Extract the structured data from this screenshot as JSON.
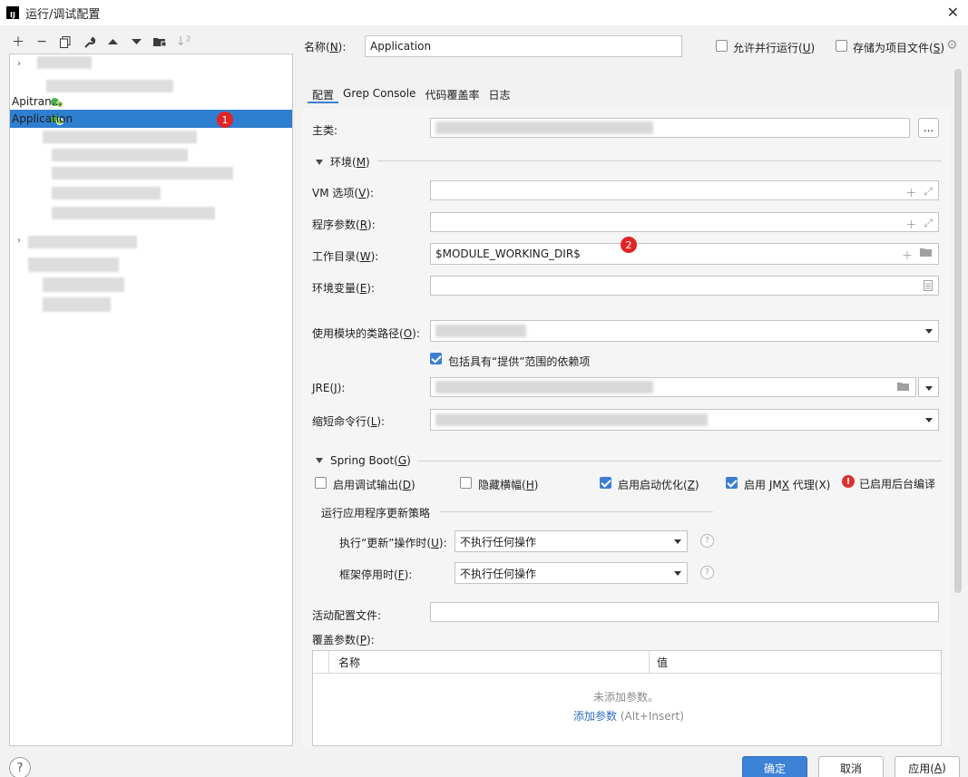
{
  "window": {
    "title": "运行/调试配置",
    "logo": "IJ"
  },
  "left_toolbar": {
    "icons": [
      "plus-icon",
      "minus-icon",
      "copy-icon",
      "wrench-icon",
      "arrow-up-icon",
      "arrow-down-icon",
      "folder-add-icon",
      "sort-icon"
    ]
  },
  "tree": {
    "items": [
      {
        "label": "Apitran...",
        "selected": false
      },
      {
        "label": "Application",
        "selected": true
      }
    ],
    "badge1": "1"
  },
  "name_field": {
    "label_pre": "名称(",
    "label_key": "N",
    "label_post": "):",
    "value": "Application"
  },
  "options": {
    "allow_parallel": {
      "label_pre": "允许并行运行(",
      "label_key": "U",
      "label_post": ")",
      "checked": false
    },
    "store_as_file": {
      "label_pre": "存储为项目文件(",
      "label_key": "S",
      "label_post": ")",
      "checked": false
    }
  },
  "tabs": [
    "配置",
    "Grep Console",
    "代码覆盖率",
    "日志"
  ],
  "main_class": {
    "label": "主类:",
    "browse": "..."
  },
  "env_section": {
    "title_pre": "环境(",
    "title_key": "M",
    "title_post": ")"
  },
  "vm_options": {
    "label_pre": "VM 选项(",
    "label_key": "V",
    "label_post": "):"
  },
  "program_args": {
    "label_pre": "程序参数(",
    "label_key": "R",
    "label_post": "):"
  },
  "working_dir": {
    "label_pre": "工作目录(",
    "label_key": "W",
    "label_post": "):",
    "value": "$MODULE_WORKING_DIR$",
    "badge2": "2"
  },
  "env_vars": {
    "label_pre": "环境变量(",
    "label_key": "E",
    "label_post": "):"
  },
  "module_classpath": {
    "label_pre": "使用模块的类路径(",
    "label_key": "O",
    "label_post": "):"
  },
  "include_provided": {
    "label": "包括具有“提供”范围的依赖项",
    "checked": true
  },
  "jre": {
    "label_pre": "JRE(",
    "label_key": "J",
    "label_post": "):"
  },
  "shorten_cmd": {
    "label_pre": "缩短命令行(",
    "label_key": "L",
    "label_post": "):"
  },
  "spring_boot": {
    "title_pre": "Spring Boot(",
    "title_key": "G",
    "title_post": ")",
    "debug_output": {
      "label_pre": "启用调试输出(",
      "label_key": "D",
      "label_post": ")",
      "checked": false
    },
    "hide_banner": {
      "label_pre": "隐藏横幅(",
      "label_key": "H",
      "label_post": ")",
      "checked": false
    },
    "launch_opt": {
      "label_pre": "启用启动优化(",
      "label_key": "Z",
      "label_post": ")",
      "checked": true
    },
    "jmx_agent": {
      "label_pre": "启用 JM",
      "label_key": "X",
      "label_post": " 代理(X)",
      "checked": true
    },
    "bg_compile": "已启用后台编译",
    "update_policy_title": "运行应用程序更新策略",
    "on_update": {
      "label_pre": "执行“更新”操作时(",
      "label_key": "U",
      "label_post": "):",
      "value": "不执行任何操作"
    },
    "on_frame": {
      "label_pre": "框架停用时(",
      "label_key": "F",
      "label_post": "):",
      "value": "不执行任何操作"
    }
  },
  "active_profiles": {
    "label": "活动配置文件:"
  },
  "override_params": {
    "label_pre": "覆盖参数(",
    "label_key": "P",
    "label_post": "):",
    "col_name": "名称",
    "col_value": "值",
    "empty": "未添加参数。",
    "add_link": "添加参数",
    "add_shortcut": "(Alt+Insert)"
  },
  "buttons": {
    "ok": "确定",
    "cancel": "取消",
    "apply_pre": "应用(",
    "apply_key": "A",
    "apply_post": ")"
  },
  "help": "?"
}
